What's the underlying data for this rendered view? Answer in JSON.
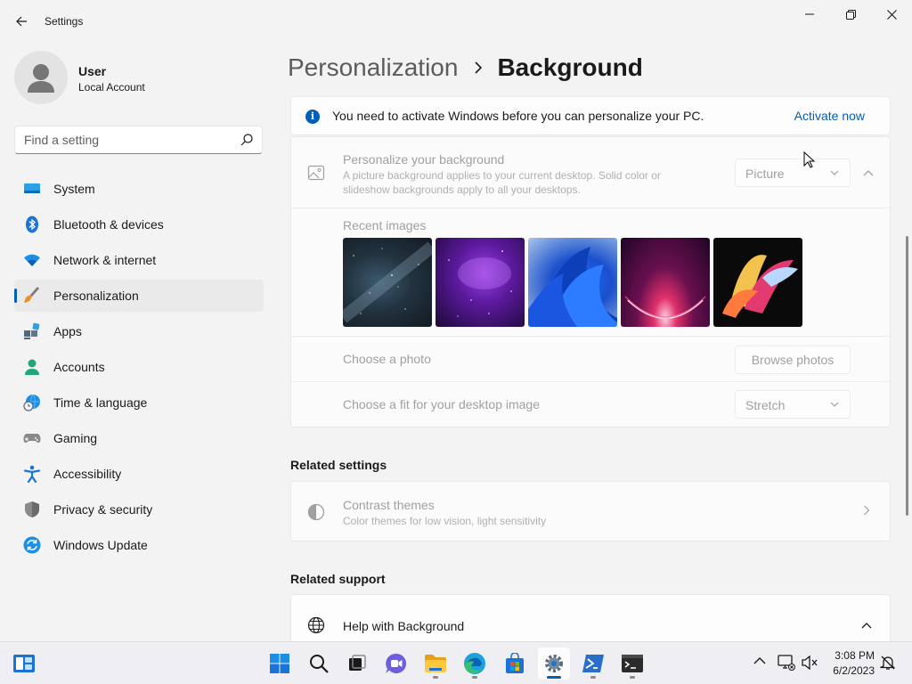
{
  "window": {
    "title": "Settings"
  },
  "profile": {
    "name": "User",
    "account_type": "Local Account"
  },
  "search": {
    "placeholder": "Find a setting",
    "value": ""
  },
  "nav": {
    "items": [
      {
        "label": "System",
        "icon": "monitor-icon",
        "selected": false
      },
      {
        "label": "Bluetooth & devices",
        "icon": "bluetooth-icon",
        "selected": false
      },
      {
        "label": "Network & internet",
        "icon": "wifi-icon",
        "selected": false
      },
      {
        "label": "Personalization",
        "icon": "paintbrush-icon",
        "selected": true
      },
      {
        "label": "Apps",
        "icon": "apps-icon",
        "selected": false
      },
      {
        "label": "Accounts",
        "icon": "person-icon",
        "selected": false
      },
      {
        "label": "Time & language",
        "icon": "globe-clock-icon",
        "selected": false
      },
      {
        "label": "Gaming",
        "icon": "gamepad-icon",
        "selected": false
      },
      {
        "label": "Accessibility",
        "icon": "accessibility-icon",
        "selected": false
      },
      {
        "label": "Privacy & security",
        "icon": "shield-icon",
        "selected": false
      },
      {
        "label": "Windows Update",
        "icon": "update-icon",
        "selected": false
      }
    ]
  },
  "breadcrumb": {
    "parent": "Personalization",
    "current": "Background"
  },
  "activation_banner": {
    "message": "You need to activate Windows before you can personalize your PC.",
    "link": "Activate now"
  },
  "background_card": {
    "title": "Personalize your background",
    "description": "A picture background applies to your current desktop. Solid color or slideshow backgrounds apply to all your desktops.",
    "type_value": "Picture",
    "recent_images_label": "Recent images",
    "recent_images": [
      "starry-sky",
      "purple-nebula",
      "blue-bloom",
      "red-horizon-glow",
      "colorful-ribbons"
    ],
    "choose_photo_label": "Choose a photo",
    "browse_button": "Browse photos",
    "fit_label": "Choose a fit for your desktop image",
    "fit_value": "Stretch"
  },
  "related_settings": {
    "heading": "Related settings",
    "items": [
      {
        "title": "Contrast themes",
        "description": "Color themes for low vision, light sensitivity"
      }
    ]
  },
  "related_support": {
    "heading": "Related support",
    "items": [
      {
        "title": "Help with Background"
      }
    ]
  },
  "taskbar": {
    "apps": [
      "start-icon",
      "search-icon",
      "task-view-icon",
      "chat-icon",
      "file-explorer-icon",
      "edge-icon",
      "store-icon",
      "settings-icon",
      "powershell-icon",
      "terminal-icon"
    ],
    "active_app": "settings-icon",
    "time": "3:08 PM",
    "date": "6/2/2023"
  },
  "colors": {
    "accent": "#005fb8",
    "background": "#f3f3f3",
    "card": "#fbfbfb",
    "disabled_text": "#a0a0a0"
  }
}
